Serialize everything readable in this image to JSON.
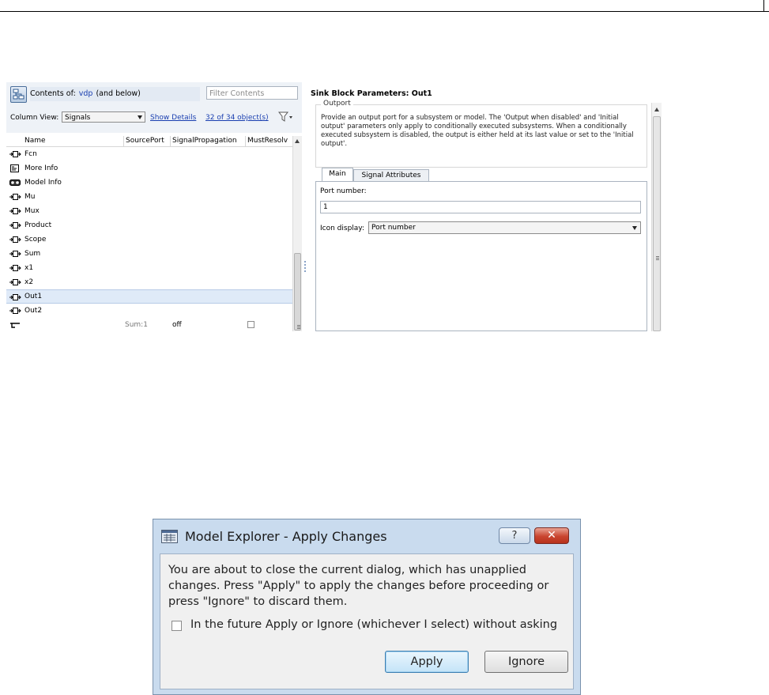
{
  "model_explorer": {
    "contents_prefix": "Contents of:",
    "contents_link": "vdp",
    "contents_suffix": "(and below)",
    "filter_placeholder": "Filter Contents",
    "column_view_label": "Column View:",
    "column_view_value": "Signals",
    "show_details": "Show Details",
    "object_count": "32 of 34 object(s)",
    "columns": [
      "Name",
      "SourcePort",
      "SignalPropagation",
      "MustResolv"
    ],
    "rows": [
      {
        "name": "Fcn",
        "icon": "block-port-icon"
      },
      {
        "name": "More Info",
        "icon": "info-block-icon"
      },
      {
        "name": "Model Info",
        "icon": "model-info-icon"
      },
      {
        "name": "Mu",
        "icon": "block-port-icon"
      },
      {
        "name": "Mux",
        "icon": "block-port-icon"
      },
      {
        "name": "Product",
        "icon": "block-port-icon"
      },
      {
        "name": "Scope",
        "icon": "block-port-icon"
      },
      {
        "name": "Sum",
        "icon": "block-port-icon"
      },
      {
        "name": "x1",
        "icon": "block-port-icon"
      },
      {
        "name": "x2",
        "icon": "block-port-icon"
      },
      {
        "name": "Out1",
        "icon": "block-port-icon",
        "selected": true
      },
      {
        "name": "Out2",
        "icon": "block-port-icon"
      },
      {
        "name": "",
        "icon": "signal-line-icon",
        "source_port": "Sum:1",
        "propagation": "off",
        "must_resolve": false
      }
    ]
  },
  "block_params": {
    "title": "Sink Block Parameters: Out1",
    "group_label": "Outport",
    "description": "Provide an output port for a subsystem or model.  The 'Output when disabled' and 'Initial output' parameters only apply to conditionally executed subsystems. When a conditionally executed subsystem is disabled, the output is either held at its last value or set to the 'Initial output'.",
    "tabs": [
      "Main",
      "Signal Attributes"
    ],
    "port_number_label": "Port number:",
    "port_number_value": "1",
    "icon_display_label": "Icon display:",
    "icon_display_value": "Port number"
  },
  "dialog": {
    "title": "Model Explorer - Apply Changes",
    "help_label": "?",
    "close_label": "✕",
    "message": "You are about to close the current dialog, which has unapplied changes. Press \"Apply\" to apply the changes before proceeding or press \"Ignore\" to discard them.",
    "checkbox_label": "In the future Apply or Ignore (whichever I select) without asking",
    "checkbox_checked": false,
    "apply_label": "Apply",
    "ignore_label": "Ignore"
  },
  "colors": {
    "selection": "#dfeaf8",
    "link": "#1a3fb0",
    "dialog_frame": "#c9dbee",
    "close_button": "#c9452f"
  }
}
